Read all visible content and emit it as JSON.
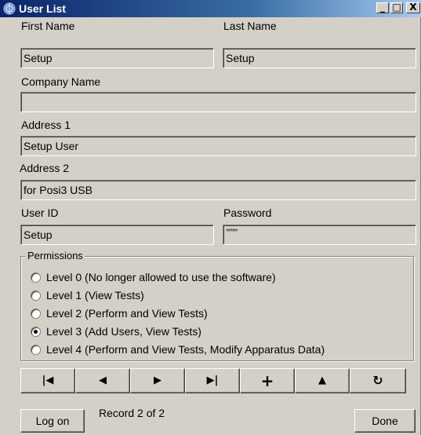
{
  "window": {
    "title": "User List",
    "minimize": "_",
    "maximize": "□",
    "close": "X"
  },
  "form": {
    "first_name_label": "First Name",
    "first_name_value": "Setup",
    "last_name_label": "Last Name",
    "last_name_value": "Setup",
    "company_label": "Company Name",
    "company_value": "",
    "address1_label": "Address 1",
    "address1_value": "Setup User",
    "address2_label": "Address 2",
    "address2_value": "for Posi3 USB",
    "userid_label": "User ID",
    "userid_value": "Setup",
    "password_label": "Password",
    "password_value": "*****"
  },
  "permissions": {
    "title": "Permissions",
    "selected_index": 3,
    "levels": [
      {
        "label": "Level 0 (No longer allowed to use the software)"
      },
      {
        "label": "Level 1 (View Tests)"
      },
      {
        "label": "Level 2 (Perform and View Tests)"
      },
      {
        "label": "Level 3 (Add Users, View Tests)"
      },
      {
        "label": "Level 4 (Perform and View Tests, Modify Apparatus Data)"
      }
    ]
  },
  "navigator": {
    "first": "|◀",
    "prev": "◀",
    "next": "▶",
    "last": "▶|",
    "add": "+",
    "up": "▲",
    "refresh": "↻"
  },
  "footer": {
    "logon_label": "Log on",
    "record_text": "Record 2 of 2",
    "done_label": "Done"
  },
  "icons": {
    "app": "app-icon"
  }
}
